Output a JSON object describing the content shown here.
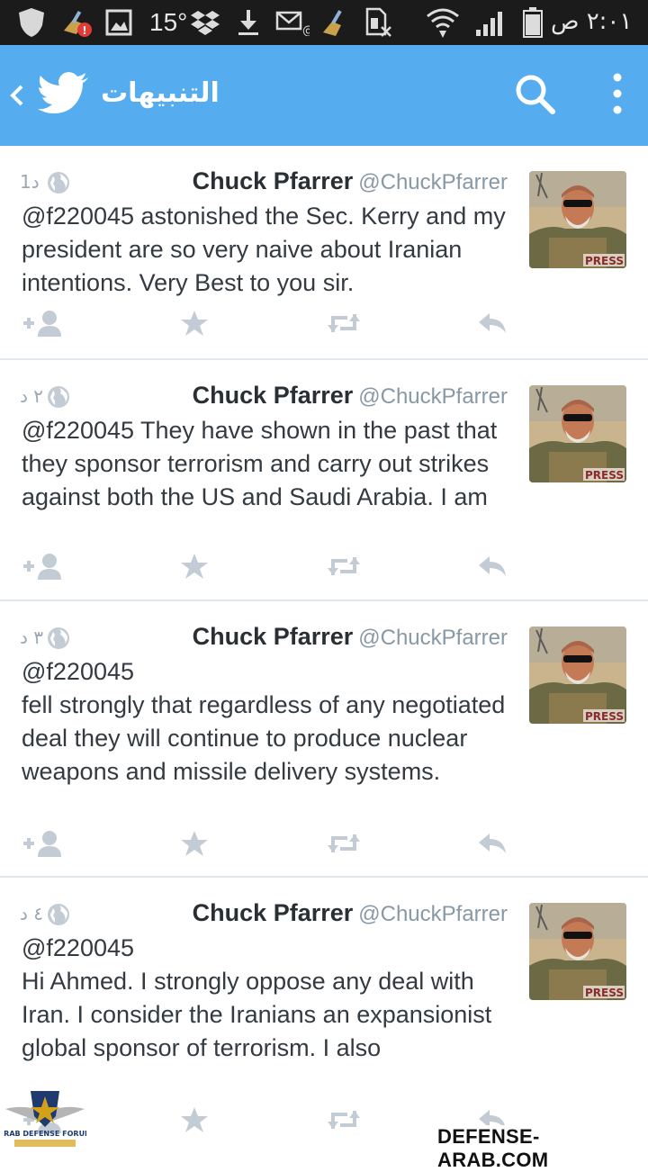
{
  "status_bar": {
    "temperature": "15°",
    "time": "٢:٠١ ص"
  },
  "app_bar": {
    "title": "التنبيهات",
    "icons": [
      "chevron-left-icon",
      "twitter-bird-icon",
      "search-icon",
      "overflow-menu-icon"
    ]
  },
  "colors": {
    "accent": "#55acee",
    "status_bar": "#1b1b1b",
    "text": "#333a40",
    "muted": "#9aa7b2"
  },
  "tweets": [
    {
      "name": "Chuck Pfarrer",
      "handle": "@ChuckPfarrer",
      "time": "1د",
      "text": "@f220045  astonished the Sec. Kerry and my president are so very naive about Iranian intentions. Very Best to you sir."
    },
    {
      "name": "Chuck Pfarrer",
      "handle": "@ChuckPfarrer",
      "time": "٢ د",
      "text": "@f220045  They have shown in the past that they sponsor terrorism and carry out strikes against both the US and Saudi Arabia.  I am"
    },
    {
      "name": "Chuck Pfarrer",
      "handle": "@ChuckPfarrer",
      "time": "٣ د",
      "text": "@f220045\nfell strongly that regardless of any negotiated deal they will continue to produce nuclear weapons and missile delivery systems."
    },
    {
      "name": "Chuck Pfarrer",
      "handle": "@ChuckPfarrer",
      "time": "٤ د",
      "text": "@f220045\nHi Ahmed.  I strongly oppose any deal with Iran.  I consider the Iranians an expansionist global sponsor of terrorism.  I also"
    }
  ],
  "watermark": {
    "text": "DEFENSE-ARAB.COM",
    "logo_text": "ARAB DEFENSE FORUM"
  }
}
